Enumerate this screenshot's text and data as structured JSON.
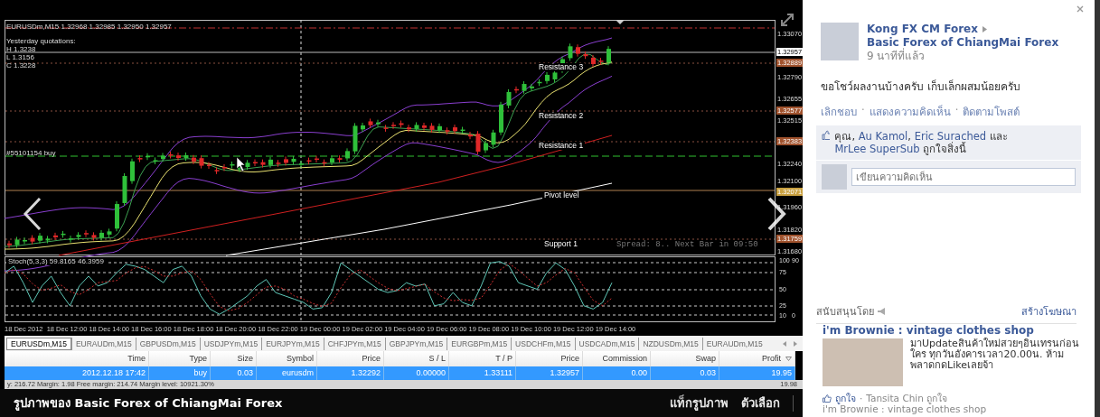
{
  "viewer": {
    "chart": {
      "header": "EURUSDm,M15  1.32968 1.32985 1.32950 1.32957",
      "quotations_title": "Yesterday quotations:",
      "quotations": [
        "H 1.3238",
        "L 1.3156",
        "C 1.3228"
      ],
      "order_label": "#55101154 buy",
      "level_labels": [
        "Resistance 3",
        "Resistance 2",
        "Resistance 1",
        "Pivot level",
        "Support 1"
      ],
      "spread": "Spread: 8.. Next Bar in 09:50",
      "price_axis": [
        {
          "text": "1.33070",
          "kind": "tick"
        },
        {
          "text": "1.32957",
          "kind": "current"
        },
        {
          "text": "1.32889",
          "kind": "level",
          "color": "#a0522d"
        },
        {
          "text": "1.32790",
          "kind": "tick"
        },
        {
          "text": "1.32655",
          "kind": "tick"
        },
        {
          "text": "1.32577",
          "kind": "level",
          "color": "#a0522d"
        },
        {
          "text": "1.32515",
          "kind": "tick"
        },
        {
          "text": "1.32383",
          "kind": "level",
          "color": "#a0522d"
        },
        {
          "text": "1.32240",
          "kind": "tick"
        },
        {
          "text": "1.32100",
          "kind": "tick"
        },
        {
          "text": "1.32071",
          "kind": "level",
          "color": "#c8a040"
        },
        {
          "text": "1.31960",
          "kind": "tick"
        },
        {
          "text": "1.31820",
          "kind": "tick"
        },
        {
          "text": "1.31759",
          "kind": "level",
          "color": "#a0522d"
        },
        {
          "text": "1.31680",
          "kind": "tick"
        }
      ],
      "oscillator": {
        "title": "Stoch(5,3,3) 59.8165 46.3959",
        "axis": [
          "100",
          "90",
          "75",
          "50",
          "25",
          "10",
          "0"
        ]
      },
      "time_axis": [
        "18 Dec 2012",
        "18 Dec 12:00",
        "18 Dec 14:00",
        "18 Dec 16:00",
        "18 Dec 18:00",
        "18 Dec 20:00",
        "18 Dec 22:00",
        "19 Dec 00:00",
        "19 Dec 02:00",
        "19 Dec 04:00",
        "19 Dec 06:00",
        "19 Dec 08:00",
        "19 Dec 10:00",
        "19 Dec 12:00",
        "19 Dec 14:00"
      ]
    },
    "symbol_tabs": [
      {
        "label": "EURUSDm,M15",
        "selected": true
      },
      {
        "label": "EURAUDm,M15",
        "selected": false
      },
      {
        "label": "GBPUSDm,M15",
        "selected": false
      },
      {
        "label": "USDJPYm,M15",
        "selected": false
      },
      {
        "label": "EURJPYm,M15",
        "selected": false
      },
      {
        "label": "CHFJPYm,M15",
        "selected": false
      },
      {
        "label": "GBPJPYm,M15",
        "selected": false
      },
      {
        "label": "EURGBPm,M15",
        "selected": false
      },
      {
        "label": "USDCHFm,M15",
        "selected": false
      },
      {
        "label": "USDCADm,M15",
        "selected": false
      },
      {
        "label": "NZDUSDm,M15",
        "selected": false
      },
      {
        "label": "EURAUDm,M15",
        "selected": false
      }
    ],
    "orders": {
      "columns": [
        "Time",
        "Type",
        "Size",
        "Symbol",
        "Price",
        "S / L",
        "T / P",
        "Price",
        "Commission",
        "Swap",
        "Profit"
      ],
      "rows": [
        {
          "cells": [
            "2012.12.18 17:42",
            "buy",
            "0.03",
            "eurusdm",
            "1.32292",
            "0.00000",
            "1.33111",
            "1.32957",
            "0.00",
            "0.03",
            "19.95"
          ],
          "selected": true
        }
      ],
      "total": "19.98"
    },
    "account_status": "y: 216.72  Margin: 1.98  Free margin: 214.74  Margin level: 10921.30%",
    "caption": "รูปภาพของ Basic Forex of ChiangMai Forex",
    "actions": [
      "แท็กรูปภาพ",
      "ตัวเลือก"
    ]
  },
  "post": {
    "author": "Kong FX CM Forex",
    "target": "Basic Forex of ChiangMai Forex",
    "time": "9 นาทีที่แล้ว",
    "text": "ขอโชว์ผลงานบ้างครับ เก็บเล็กผสมน้อยครับ",
    "actions": [
      {
        "kind": "link",
        "text": "เลิกชอบ"
      },
      {
        "kind": "separator",
        "text": "·"
      },
      {
        "kind": "link",
        "text": "แสดงความคิดเห็น"
      },
      {
        "kind": "separator",
        "text": "·"
      },
      {
        "kind": "link",
        "text": "ติดตามโพสต์"
      }
    ],
    "likes": [
      {
        "kind": "text",
        "text": "คุณ, "
      },
      {
        "kind": "link",
        "text": "Au Kamol"
      },
      {
        "kind": "text",
        "text": ", "
      },
      {
        "kind": "link",
        "text": "Eric Surached"
      },
      {
        "kind": "text",
        "text": " และ "
      },
      {
        "kind": "link",
        "text": "MrLee SuperSub"
      },
      {
        "kind": "text",
        "text": " ถูกใจสิ่งนี้"
      }
    ],
    "comment": {
      "placeholder": "เขียนความคิดเห็น"
    }
  },
  "sponsored": {
    "title": "สนับสนุนโดย",
    "create_ad": "สร้างโฆษณา",
    "ad": {
      "title": "i'm Brownie : vintage clothes shop",
      "text": "มาUpdateสินค้าใหม่สวยๆอินเทรนก่อนใคร ทุกวันอังคารเวลา20.00น. ห้ามพลาดกดLikeเลยจ้า",
      "like": "ถูกใจ",
      "separator": "·",
      "social": "Tansita Chin ถูกใจ",
      "page": "i'm Brownie : vintage clothes shop"
    }
  }
}
